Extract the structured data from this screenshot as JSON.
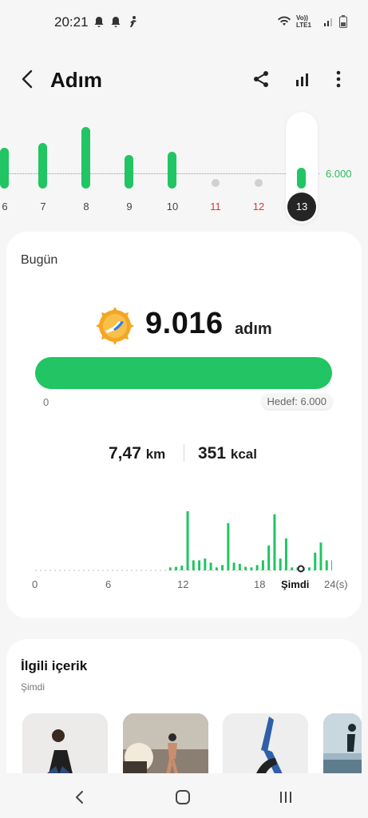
{
  "status_bar": {
    "time": "20:21",
    "network": "Vo)) LTE1"
  },
  "header": {
    "title": "Adım"
  },
  "week": {
    "goal_label": "6.000",
    "days": [
      {
        "label": "6",
        "steps": 5200,
        "red": false
      },
      {
        "label": "7",
        "steps": 5800,
        "red": false
      },
      {
        "label": "8",
        "steps": 7800,
        "red": false
      },
      {
        "label": "9",
        "steps": 4300,
        "red": false
      },
      {
        "label": "10",
        "steps": 4700,
        "red": false
      },
      {
        "label": "11",
        "steps": 0,
        "red": true
      },
      {
        "label": "12",
        "steps": 0,
        "red": true
      },
      {
        "label": "13",
        "steps": 2600,
        "red": false,
        "selected": true
      }
    ]
  },
  "today": {
    "label": "Bugün",
    "steps": "9.016",
    "steps_unit": "adım",
    "progress_percent": 100,
    "progress_start": "0",
    "goal": "Hedef: 6.000",
    "distance": "7,47",
    "distance_unit": "km",
    "calories": "351",
    "calories_unit": "kcal",
    "hourly_ticks": [
      "0",
      "6",
      "12",
      "18",
      "Şimdi",
      "24(s)"
    ],
    "hourly_steps": [
      0,
      0,
      0,
      0,
      0,
      0,
      0,
      0.05,
      0.06,
      0.08,
      1.0,
      0.17,
      0.17,
      0.2,
      0.13,
      0.05,
      0.09,
      0.8,
      0.13,
      0.11,
      0.06,
      0.05,
      0.09,
      0.17,
      0.42,
      0.95,
      0.2,
      0.54,
      0.05,
      0.05,
      0.05,
      0.05,
      0.3,
      0.47,
      0.17,
      0.17,
      0.3
    ]
  },
  "related": {
    "title": "İlgili içerik",
    "subtitle": "Şimdi"
  },
  "colors": {
    "accent": "#21c563",
    "goal_text": "#2cb95d",
    "weekend": "#d33a3a"
  }
}
